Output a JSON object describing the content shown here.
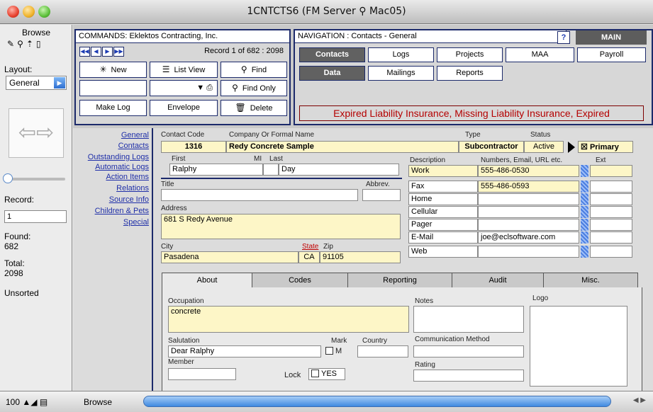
{
  "window": {
    "title": "1CNTCTS6 (FM Server ⚲ Mac05)"
  },
  "status_area": {
    "mode": "Browse",
    "layout_label": "Layout:",
    "layout_value": "General",
    "record_label": "Record:",
    "record_value": "1",
    "found_label": "Found:",
    "found_value": "682",
    "total_label": "Total:",
    "total_value": "2098",
    "sort_status": "Unsorted"
  },
  "commands": {
    "header": "COMMANDS: Eklektos Contracting, Inc.",
    "record_text": "Record 1 of 682 : 2098",
    "nav_arrows": [
      "◀◀",
      "◀",
      "▶",
      "▶▶"
    ],
    "new": "New",
    "list_view": "List View",
    "find": "Find",
    "find_only": "Find Only",
    "make_log": "Make Log",
    "envelope": "Envelope",
    "delete": "Delete"
  },
  "navigation": {
    "header": "NAVIGATION : Contacts - General",
    "help": "?",
    "main": "MAIN",
    "row1": [
      "Contacts",
      "Logs",
      "Projects",
      "MAA",
      "Payroll"
    ],
    "row2": [
      "Data",
      "Mailings",
      "Reports"
    ],
    "alert": "Expired Liability Insurance, Missing Liability Insurance, Expired"
  },
  "side_links": [
    "General",
    "Contacts",
    "Outstanding Logs",
    "Automatic Logs",
    "Action Items",
    "Relations",
    "Source Info",
    "Children & Pets",
    "Special"
  ],
  "contact": {
    "labels": {
      "code": "Contact Code",
      "company": "Company Or Formal Name",
      "type": "Type",
      "status": "Status",
      "first": "First",
      "mi": "MI",
      "last": "Last",
      "description": "Description",
      "numbers": "Numbers, Email, URL etc.",
      "ext": "Ext",
      "title": "Title",
      "abbrev": "Abbrev.",
      "address": "Address",
      "city": "City",
      "state": "State",
      "zip": "Zip"
    },
    "code": "1316",
    "company": "Redy Concrete Sample",
    "type": "Subcontractor",
    "status": "Active",
    "primary": "Primary",
    "first": "Ralphy",
    "mi": "",
    "last": "Day",
    "address": "681 S Redy Avenue",
    "city": "Pasadena",
    "state": "CA",
    "zip": "91105",
    "phones": [
      {
        "desc": "Work",
        "number": "555-486-0530"
      },
      {
        "desc": "Fax",
        "number": "555-486-0593"
      },
      {
        "desc": "Home",
        "number": ""
      },
      {
        "desc": "Cellular",
        "number": ""
      },
      {
        "desc": "Pager",
        "number": ""
      },
      {
        "desc": "E-Mail",
        "number": "joe@eclsoftware.com"
      },
      {
        "desc": "Web",
        "number": ""
      }
    ]
  },
  "tabs": [
    "About",
    "Codes",
    "Reporting",
    "Audit",
    "Misc."
  ],
  "about": {
    "occupation_label": "Occupation",
    "occupation": "concrete",
    "notes_label": "Notes",
    "logo_label": "Logo",
    "salutation_label": "Salutation",
    "salutation": "Dear Ralphy",
    "mark_label": "Mark",
    "mark_value": "M",
    "country_label": "Country",
    "comm_label": "Communication Method",
    "member_label": "Member",
    "lock_label": "Lock",
    "lock_value": "YES",
    "rating_label": "Rating"
  },
  "bottom": {
    "zoom": "100",
    "mode": "Browse"
  }
}
